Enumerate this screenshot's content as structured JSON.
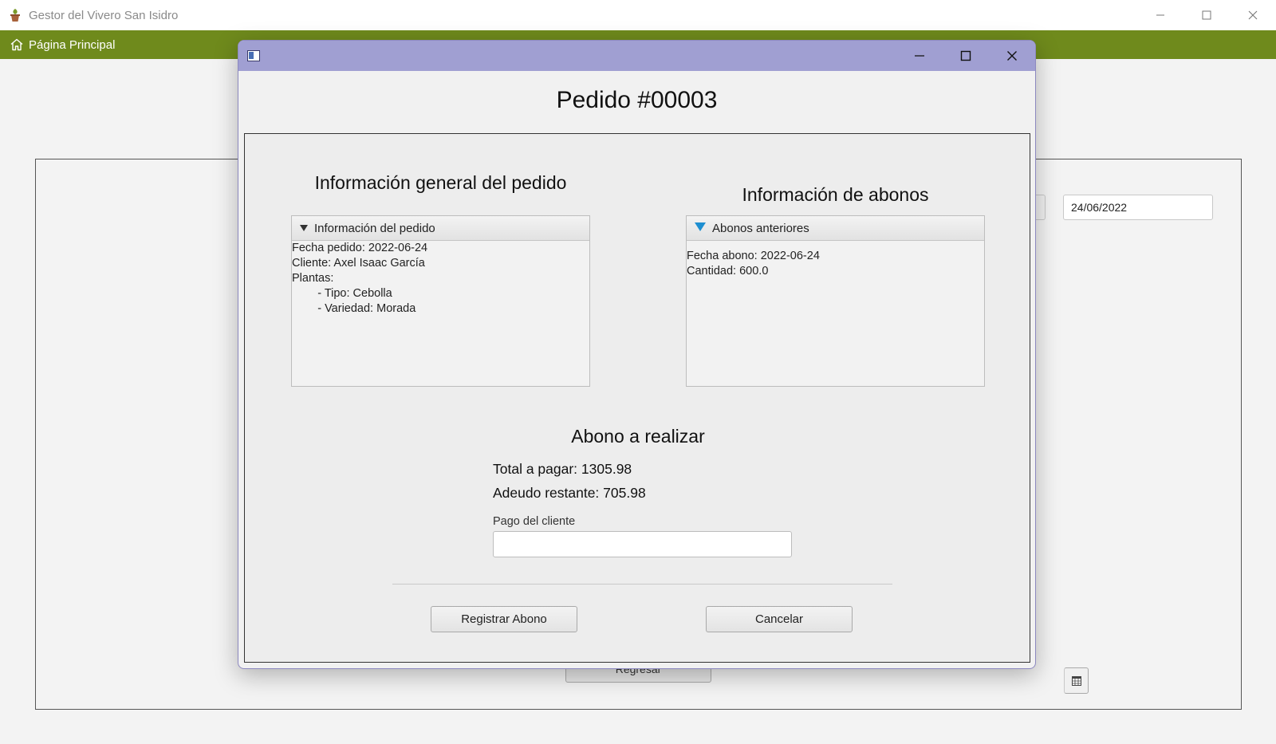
{
  "app": {
    "title": "Gestor del Vivero San Isidro",
    "brand_color": "#6f8a1c"
  },
  "menubar": {
    "home_label": "Página Principal"
  },
  "background": {
    "date_value": "24/06/2022",
    "back_button_label": "Regresar"
  },
  "dialog": {
    "heading": "Pedido #00003",
    "titlebar_color": "#a09fd2",
    "general": {
      "title": "Información general del pedido",
      "accordion_label": "Información del pedido",
      "lines": [
        "Fecha pedido: 2022-06-24",
        "Cliente: Axel Isaac García",
        "Plantas:",
        "        - Tipo: Cebolla",
        "        - Variedad: Morada"
      ]
    },
    "abonos": {
      "title": "Información de abonos",
      "accordion_label": "Abonos anteriores",
      "lines": [
        "Fecha abono: 2022-06-24",
        "Cantidad: 600.0"
      ]
    },
    "payment": {
      "title": "Abono a realizar",
      "total": "Total a pagar: 1305.98",
      "remaining": "Adeudo restante: 705.98",
      "input_label": "Pago del cliente",
      "input_value": ""
    },
    "buttons": {
      "register": "Registrar Abono",
      "cancel": "Cancelar"
    }
  }
}
